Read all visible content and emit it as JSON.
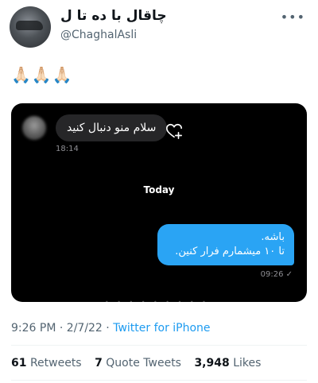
{
  "profile": {
    "display_name": "چاقال با ده تا ل",
    "handle": "@ChaghalAsli",
    "more_icon": "more-options-icon"
  },
  "tweet": {
    "emoji_text": "🙏🏻🙏🏻🙏🏻"
  },
  "media": {
    "incoming_message": "سلام منو دنبال کنید",
    "incoming_time": "18:14",
    "date_separator": "Today",
    "outgoing_lines": [
      "باشه.",
      "تا ۱۰ میشمارم فرار کنین."
    ],
    "outgoing_time": "09:26 ✓"
  },
  "meta": {
    "time": "9:26 PM",
    "separator": " · ",
    "date": "2/7/22",
    "source": "Twitter for iPhone"
  },
  "stats": {
    "retweets_count": "61",
    "retweets_label": "Retweets",
    "quotes_count": "7",
    "quotes_label": "Quote Tweets",
    "likes_count": "3,948",
    "likes_label": "Likes"
  }
}
